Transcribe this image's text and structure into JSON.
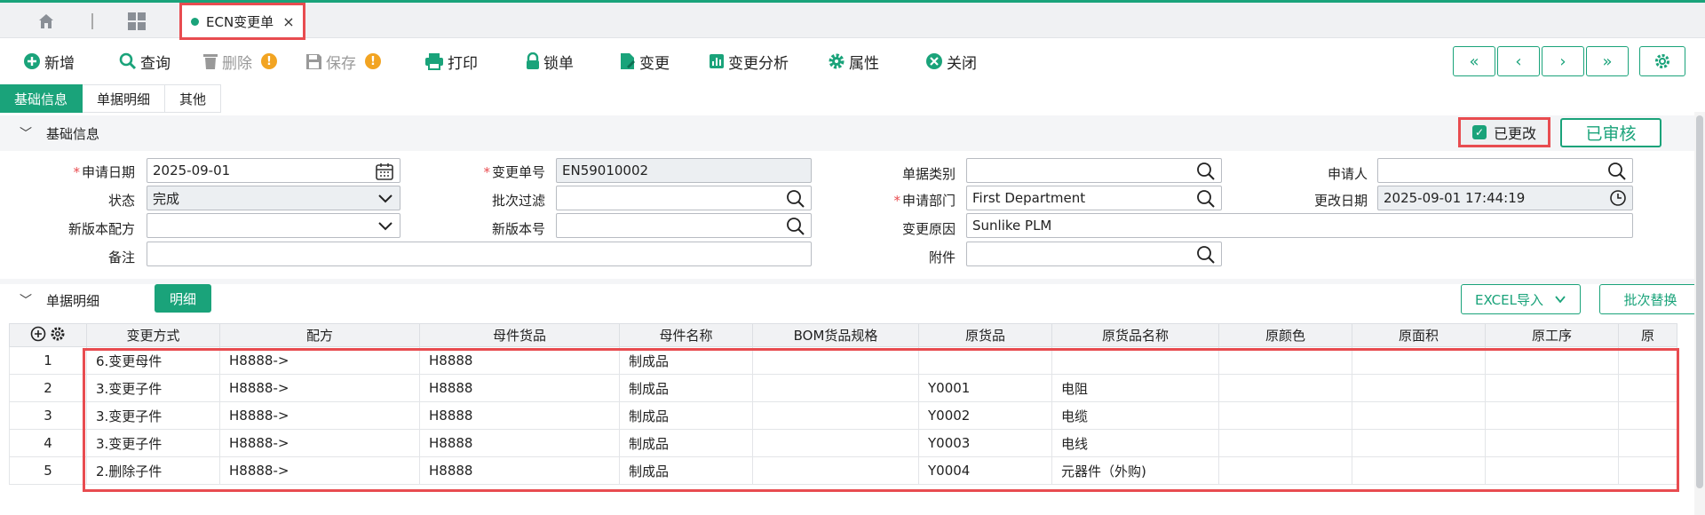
{
  "window": {
    "tab": {
      "label": "ECN变更单",
      "close": "×"
    }
  },
  "toolbar": {
    "new": "新增",
    "query": "查询",
    "delete": "删除",
    "save": "保存",
    "print": "打印",
    "lock": "锁单",
    "change": "变更",
    "analysis": "变更分析",
    "property": "属性",
    "close": "关闭",
    "warn_mark": "!"
  },
  "nav": {
    "first": "«",
    "prev": "‹",
    "next": "›",
    "last": "»"
  },
  "subtabs": [
    "基础信息",
    "单据明细",
    "其他"
  ],
  "basic": {
    "title": "基础信息",
    "changed_label": "已更改",
    "audited_label": "已审核",
    "fields": {
      "apply_date": {
        "label": "申请日期",
        "value": "2025-09-01"
      },
      "change_no": {
        "label": "变更单号",
        "value": "EN59010002"
      },
      "doc_type": {
        "label": "单据类别",
        "value": ""
      },
      "applicant": {
        "label": "申请人",
        "value": ""
      },
      "status": {
        "label": "状态",
        "value": "完成"
      },
      "batch_filter": {
        "label": "批次过滤",
        "value": ""
      },
      "dept": {
        "label": "申请部门",
        "value": "First Department"
      },
      "modify_date": {
        "label": "更改日期",
        "value": "2025-09-01 17:44:19"
      },
      "new_formula": {
        "label": "新版本配方",
        "value": ""
      },
      "new_version": {
        "label": "新版本号",
        "value": ""
      },
      "reason": {
        "label": "变更原因",
        "value": "Sunlike PLM"
      },
      "remark": {
        "label": "备注",
        "value": ""
      },
      "attachment": {
        "label": "附件",
        "value": ""
      }
    }
  },
  "detail": {
    "title": "单据明细",
    "tab": "明细",
    "excel": "EXCEL导入",
    "batch_replace": "批次替换",
    "columns": [
      "变更方式",
      "配方",
      "母件货品",
      "母件名称",
      "BOM货品规格",
      "原货品",
      "原货品名称",
      "原颜色",
      "原面积",
      "原工序",
      "原"
    ],
    "rows": [
      {
        "no": "1",
        "cells": [
          "6.变更母件",
          "H8888->",
          "H8888",
          "制成品",
          "",
          "",
          "",
          "",
          "",
          "",
          ""
        ]
      },
      {
        "no": "2",
        "cells": [
          "3.变更子件",
          "H8888->",
          "H8888",
          "制成品",
          "",
          "Y0001",
          "电阻",
          "",
          "",
          "",
          ""
        ]
      },
      {
        "no": "3",
        "cells": [
          "3.变更子件",
          "H8888->",
          "H8888",
          "制成品",
          "",
          "Y0002",
          "电缆",
          "",
          "",
          "",
          ""
        ]
      },
      {
        "no": "4",
        "cells": [
          "3.变更子件",
          "H8888->",
          "H8888",
          "制成品",
          "",
          "Y0003",
          "电线",
          "",
          "",
          "",
          ""
        ]
      },
      {
        "no": "5",
        "cells": [
          "2.删除子件",
          "H8888->",
          "H8888",
          "制成品",
          "",
          "Y0004",
          "元器件（外购)",
          "",
          "",
          "",
          ""
        ]
      }
    ]
  },
  "colors": {
    "accent": "#1aa37a",
    "highlight": "#e84c50",
    "warning": "#f2a422"
  }
}
